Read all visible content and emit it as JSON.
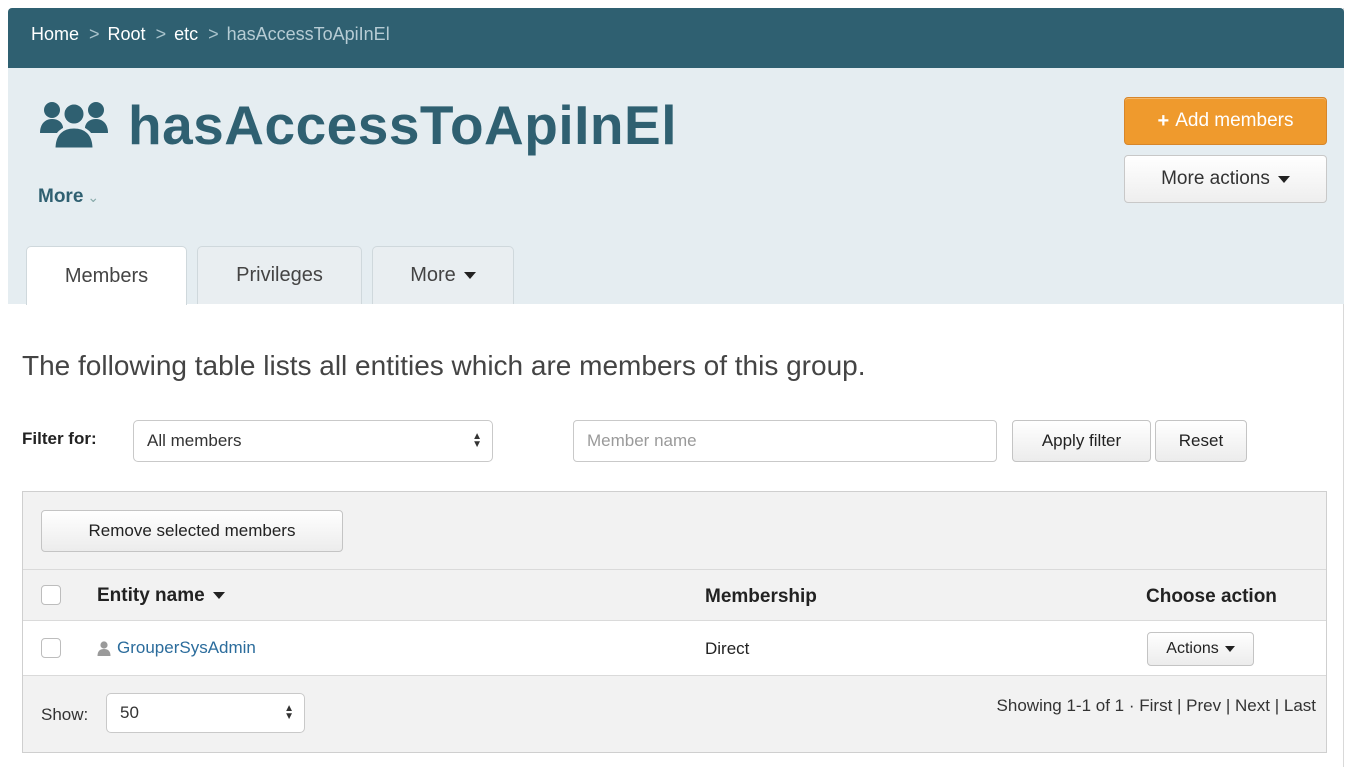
{
  "breadcrumb": {
    "items": [
      {
        "label": "Home"
      },
      {
        "label": "Root"
      },
      {
        "label": "etc"
      }
    ],
    "current": "hasAccessToApiInEl",
    "separator": ">"
  },
  "header": {
    "title": "hasAccessToApiInEl",
    "icon": "group-icon",
    "more_label": "More",
    "add_members_label": "Add members",
    "more_actions_label": "More actions"
  },
  "tabs": [
    {
      "label": "Members",
      "active": true
    },
    {
      "label": "Privileges",
      "active": false
    },
    {
      "label": "More",
      "active": false
    }
  ],
  "content": {
    "description": "The following table lists all entities which are members of this group.",
    "filter_label": "Filter for:",
    "filter_select_value": "All members",
    "member_name_placeholder": "Member name",
    "apply_filter_label": "Apply filter",
    "reset_label": "Reset"
  },
  "table": {
    "remove_selected_label": "Remove selected members",
    "columns": {
      "entity": "Entity name",
      "membership": "Membership",
      "action": "Choose action"
    },
    "rows": [
      {
        "entity": "GrouperSysAdmin",
        "membership": "Direct",
        "action_label": "Actions"
      }
    ],
    "footer": {
      "show_label": "Show:",
      "page_size": "50",
      "showing_text": "Showing 1-1 of 1 · ",
      "first": "First",
      "prev": "Prev",
      "next": "Next",
      "last": "Last"
    }
  },
  "colors": {
    "primary": "#2f6071",
    "header_bg": "#e5edf1",
    "add_button": "#ef9a2d",
    "link": "#2b6c9c"
  }
}
